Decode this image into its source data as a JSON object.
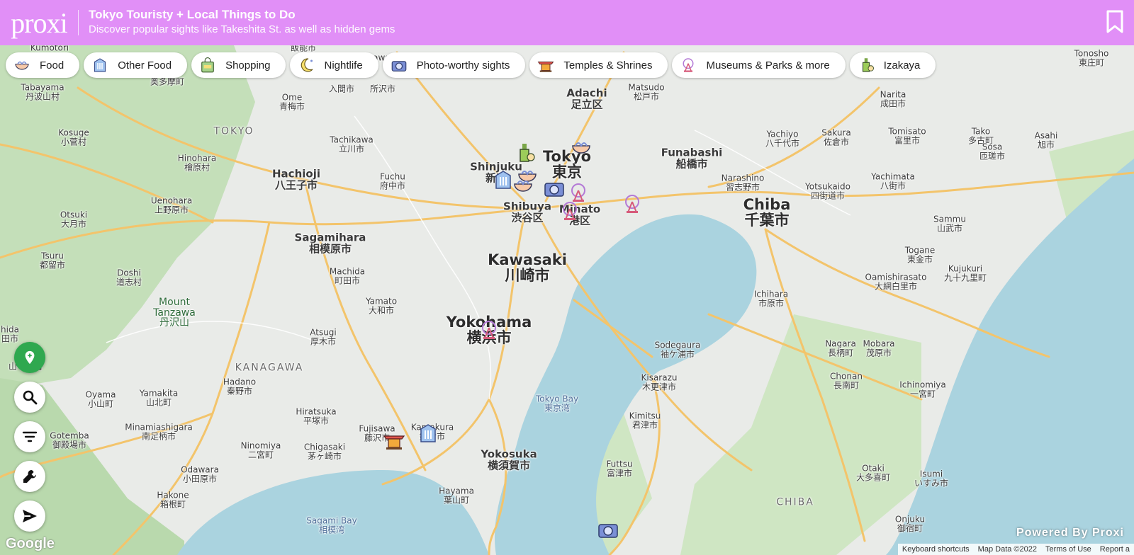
{
  "header": {
    "logo": "proxi",
    "title": "Tokyo Touristy + Local Things to Do",
    "subtitle": "Discover popular sights like Takeshita St. as well as hidden gems"
  },
  "colors": {
    "header_bg": "#e18ff7",
    "road": "#f3c46b",
    "water": "#aad3df",
    "park": "#c4dfb9",
    "control_green": "#2fa84f"
  },
  "categories": [
    {
      "label": "Food",
      "icon": "ramen-bowl-icon"
    },
    {
      "label": "Other Food",
      "icon": "fork-knife-icon"
    },
    {
      "label": "Shopping",
      "icon": "shopping-bag-icon"
    },
    {
      "label": "Nightlife",
      "icon": "moon-stars-icon"
    },
    {
      "label": "Photo-worthy sights",
      "icon": "camera-icon"
    },
    {
      "label": "Temples & Shrines",
      "icon": "temple-icon"
    },
    {
      "label": "Museums & Parks & more",
      "icon": "ferris-wheel-icon"
    },
    {
      "label": "Izakaya",
      "icon": "bottle-glass-icon"
    }
  ],
  "places": [
    {
      "label": "Kumotori"
    },
    {
      "label": "飯能市"
    },
    {
      "label": "Tokorozawa"
    },
    {
      "label": "Tonosho\n東庄町"
    },
    {
      "label": "Tabayama\n丹波山村"
    },
    {
      "label": "奥多摩町"
    },
    {
      "label": "Ome\n青梅市"
    },
    {
      "label": "入間市"
    },
    {
      "label": "所沢市"
    },
    {
      "label": "Adachi\n足立区"
    },
    {
      "label": "Matsudo\n松戸市"
    },
    {
      "label": "Narita\n成田市"
    },
    {
      "label": "Kosuge\n小菅村"
    },
    {
      "label": "TOKYO"
    },
    {
      "label": "Tachikawa\n立川市"
    },
    {
      "label": "Yachiyo\n八千代市"
    },
    {
      "label": "Sakura\n佐倉市"
    },
    {
      "label": "Tomisato\n富里市"
    },
    {
      "label": "Tako\n多古町"
    },
    {
      "label": "Asahi\n旭市"
    },
    {
      "label": "Hinohara\n檜原村"
    },
    {
      "label": "Funabashi\n船橋市"
    },
    {
      "label": "Sosa\n匝瑳市"
    },
    {
      "label": "Hachioji\n八王子市"
    },
    {
      "label": "Fuchu\n府中市"
    },
    {
      "label": "Shinjuku\n新宿"
    },
    {
      "label": "Tokyo\n東京"
    },
    {
      "label": "Narashino\n習志野市"
    },
    {
      "label": "Yachimata\n八街市"
    },
    {
      "label": "Uenohara\n上野原市"
    },
    {
      "label": "Yotsukaido\n四街道市"
    },
    {
      "label": "Chiba\n千葉市"
    },
    {
      "label": "Otsuki\n大月市"
    },
    {
      "label": "Shibuya\n渋谷区"
    },
    {
      "label": "Minato\n港区"
    },
    {
      "label": "Sammu\n山武市"
    },
    {
      "label": "Sagamihara\n相模原市"
    },
    {
      "label": "Togane\n東金市"
    },
    {
      "label": "Kawasaki\n川崎市"
    },
    {
      "label": "Tsuru\n都留市"
    },
    {
      "label": "Machida\n町田市"
    },
    {
      "label": "Kujukuri\n九十九里町"
    },
    {
      "label": "Oamishirasato\n大網白里市"
    },
    {
      "label": "Doshi\n道志村"
    },
    {
      "label": "Yamato\n大和市"
    },
    {
      "label": "Ichihara\n市原市"
    },
    {
      "label": "Mount\nTanzawa\n丹沢山"
    },
    {
      "label": "Yokohama\n横浜市"
    },
    {
      "label": "Atsugi\n厚木市"
    },
    {
      "label": "Sodegaura\n袖ケ浦市"
    },
    {
      "label": "Nagara\n長柄町"
    },
    {
      "label": "Mobara\n茂原市"
    },
    {
      "label": "KANAGAWA"
    },
    {
      "label": "Hadano\n秦野市"
    },
    {
      "label": "Kisarazu\n木更津市"
    },
    {
      "label": "Chonan\n長南町"
    },
    {
      "label": "Ichinomiya\n一宮町"
    },
    {
      "label": "Oyama\n小山町"
    },
    {
      "label": "Yamakita\n山北町"
    },
    {
      "label": "Tokyo Bay\n東京湾"
    },
    {
      "label": "Hiratsuka\n平塚市"
    },
    {
      "label": "Kimitsu\n君津市"
    },
    {
      "label": "Gotemba\n御殿場市"
    },
    {
      "label": "Minamiashigara\n南足柄市"
    },
    {
      "label": "Fujisawa\n藤沢市"
    },
    {
      "label": "Kamakura\n鎌倉市"
    },
    {
      "label": "Ninomiya\n二宮町"
    },
    {
      "label": "Chigasaki\n茅ヶ崎市"
    },
    {
      "label": "Yokosuka\n横須賀市"
    },
    {
      "label": "Futtsu\n富津市"
    },
    {
      "label": "Odawara\n小田原市"
    },
    {
      "label": "Otaki\n大多喜町"
    },
    {
      "label": "Isumi\nいすみ市"
    },
    {
      "label": "Hakone\n箱根町"
    },
    {
      "label": "Hayama\n葉山町"
    },
    {
      "label": "CHIBA"
    },
    {
      "label": "Onjuku\n御宿町"
    },
    {
      "label": "Sagami Bay\n相模湾"
    },
    {
      "label": "hida\n田市"
    },
    {
      "label": "山中湖村"
    }
  ],
  "footer": {
    "powered_by": "Powered By Proxi",
    "google": "Google",
    "keyboard": "Keyboard shortcuts",
    "map_data": "Map Data ©2022",
    "terms": "Terms of Use",
    "report": "Report a"
  }
}
